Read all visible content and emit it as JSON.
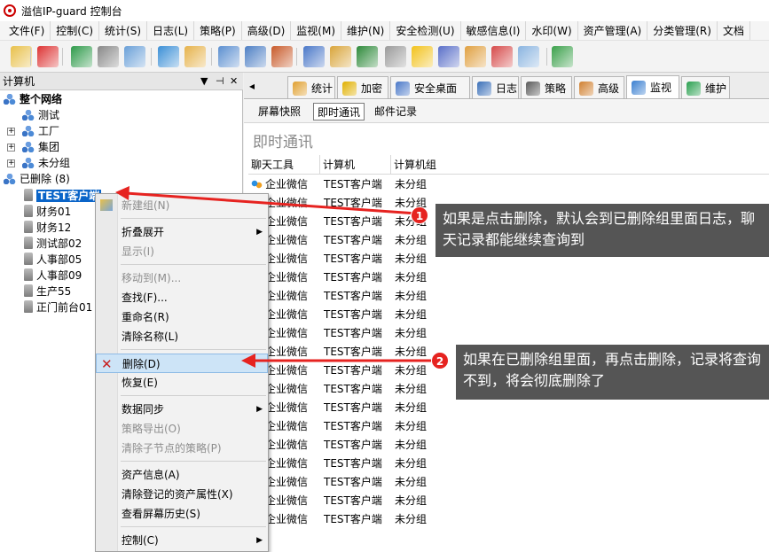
{
  "window": {
    "title": "溢信IP-guard 控制台"
  },
  "menu": [
    "文件(F)",
    "控制(C)",
    "统计(S)",
    "日志(L)",
    "策略(P)",
    "高级(D)",
    "监视(M)",
    "维护(N)",
    "安全检测(U)",
    "敏感信息(I)",
    "水印(W)",
    "资产管理(A)",
    "分类管理(R)",
    "文档"
  ],
  "left_panel": {
    "title": "计算机",
    "ctrl_dropdown": "▼",
    "ctrl_pin": "⊣",
    "ctrl_close": "✕"
  },
  "tree": {
    "root": "整个网络",
    "groups": [
      "测试",
      "工厂",
      "集团",
      "未分组"
    ],
    "deleted": "已删除 (8)",
    "deleted_items": [
      "TEST客户端",
      "财务01",
      "财务12",
      "测试部02",
      "人事部05",
      "人事部09",
      "生产55",
      "正门前台01"
    ]
  },
  "context_menu": [
    {
      "label": "新建组(N)",
      "disabled": true
    },
    {
      "sep": true
    },
    {
      "label": "折叠展开",
      "submenu": true
    },
    {
      "label": "显示(I)",
      "disabled": true
    },
    {
      "sep": true
    },
    {
      "label": "移动到(M)...",
      "disabled": true
    },
    {
      "label": "查找(F)..."
    },
    {
      "label": "重命名(R)"
    },
    {
      "label": "清除名称(L)"
    },
    {
      "sep": true
    },
    {
      "label": "删除(D)",
      "highlight": true
    },
    {
      "label": "恢复(E)"
    },
    {
      "sep": true
    },
    {
      "label": "数据同步",
      "submenu": true
    },
    {
      "label": "策略导出(O)",
      "disabled": true
    },
    {
      "label": "清除子节点的策略(P)",
      "disabled": true
    },
    {
      "sep": true
    },
    {
      "label": "资产信息(A)"
    },
    {
      "label": "清除登记的资产属性(X)"
    },
    {
      "label": "查看屏幕历史(S)"
    },
    {
      "sep": true
    },
    {
      "label": "控制(C)",
      "submenu": true
    }
  ],
  "tabs": [
    "统计",
    "加密",
    "安全桌面",
    "日志",
    "策略",
    "高级",
    "监视",
    "维护"
  ],
  "tab_scroll_left": "◂",
  "subtabs": [
    "屏幕快照",
    "即时通讯",
    "邮件记录"
  ],
  "page_title": "即时通讯",
  "grid": {
    "columns": [
      "聊天工具",
      "计算机",
      "计算机组"
    ],
    "row": {
      "tool": "企业微信",
      "computer": "TEST客户端",
      "group": "未分组"
    },
    "row_count": 19
  },
  "callouts": [
    {
      "num": "1",
      "text": "如果是点击删除，默认会到已删除组里面日志，聊天记录都能继续查询到"
    },
    {
      "num": "2",
      "text": "如果在已删除组里面，再点击删除，记录将查询不到，将会彻底删除了"
    }
  ],
  "colors": {
    "accent": "#0a64c8",
    "annotation": "#e62320",
    "callout_bg": "#555555"
  }
}
